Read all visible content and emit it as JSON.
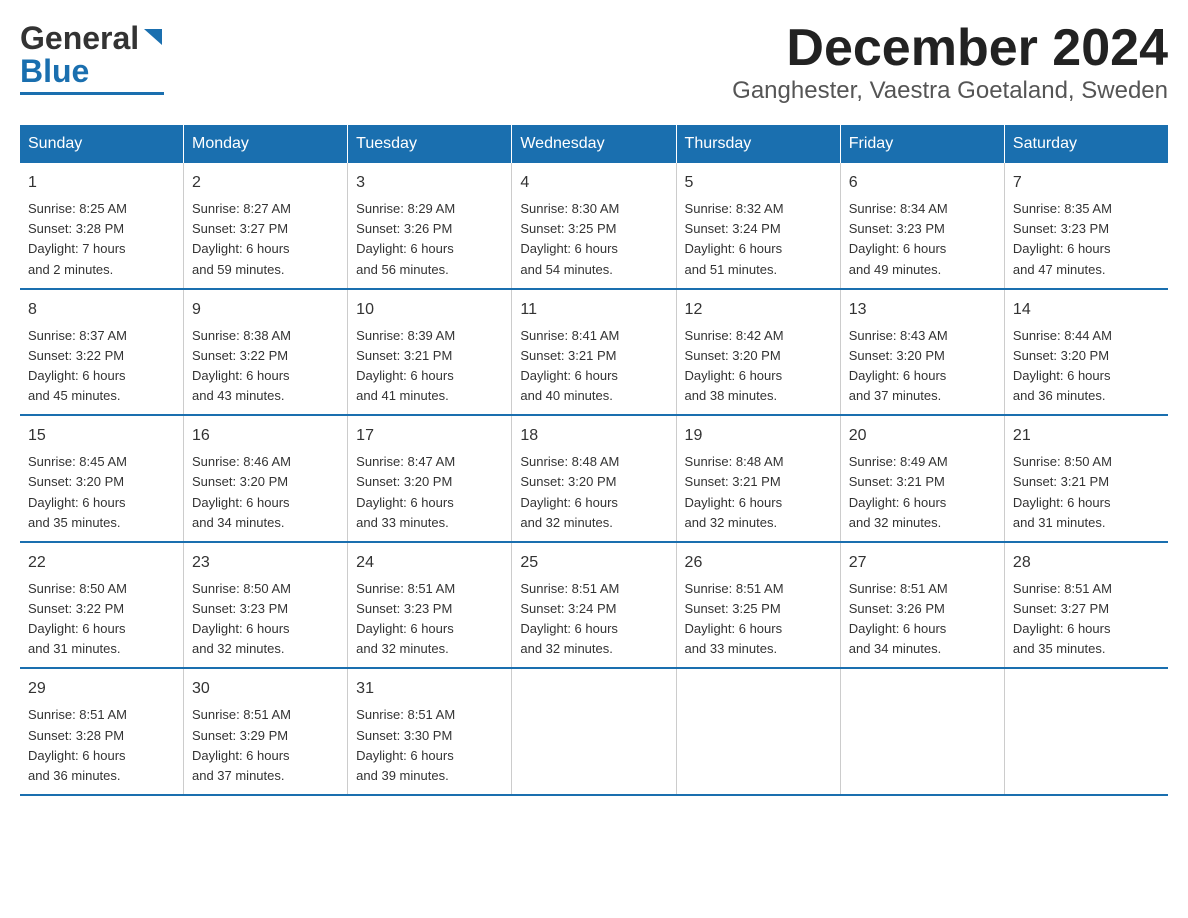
{
  "logo": {
    "general": "General",
    "blue": "Blue",
    "triangle": "▶"
  },
  "title": "December 2024",
  "subtitle": "Ganghester, Vaestra Goetaland, Sweden",
  "days_of_week": [
    "Sunday",
    "Monday",
    "Tuesday",
    "Wednesday",
    "Thursday",
    "Friday",
    "Saturday"
  ],
  "weeks": [
    [
      {
        "day": "1",
        "sunrise": "8:25 AM",
        "sunset": "3:28 PM",
        "daylight": "7 hours and 2 minutes."
      },
      {
        "day": "2",
        "sunrise": "8:27 AM",
        "sunset": "3:27 PM",
        "daylight": "6 hours and 59 minutes."
      },
      {
        "day": "3",
        "sunrise": "8:29 AM",
        "sunset": "3:26 PM",
        "daylight": "6 hours and 56 minutes."
      },
      {
        "day": "4",
        "sunrise": "8:30 AM",
        "sunset": "3:25 PM",
        "daylight": "6 hours and 54 minutes."
      },
      {
        "day": "5",
        "sunrise": "8:32 AM",
        "sunset": "3:24 PM",
        "daylight": "6 hours and 51 minutes."
      },
      {
        "day": "6",
        "sunrise": "8:34 AM",
        "sunset": "3:23 PM",
        "daylight": "6 hours and 49 minutes."
      },
      {
        "day": "7",
        "sunrise": "8:35 AM",
        "sunset": "3:23 PM",
        "daylight": "6 hours and 47 minutes."
      }
    ],
    [
      {
        "day": "8",
        "sunrise": "8:37 AM",
        "sunset": "3:22 PM",
        "daylight": "6 hours and 45 minutes."
      },
      {
        "day": "9",
        "sunrise": "8:38 AM",
        "sunset": "3:22 PM",
        "daylight": "6 hours and 43 minutes."
      },
      {
        "day": "10",
        "sunrise": "8:39 AM",
        "sunset": "3:21 PM",
        "daylight": "6 hours and 41 minutes."
      },
      {
        "day": "11",
        "sunrise": "8:41 AM",
        "sunset": "3:21 PM",
        "daylight": "6 hours and 40 minutes."
      },
      {
        "day": "12",
        "sunrise": "8:42 AM",
        "sunset": "3:20 PM",
        "daylight": "6 hours and 38 minutes."
      },
      {
        "day": "13",
        "sunrise": "8:43 AM",
        "sunset": "3:20 PM",
        "daylight": "6 hours and 37 minutes."
      },
      {
        "day": "14",
        "sunrise": "8:44 AM",
        "sunset": "3:20 PM",
        "daylight": "6 hours and 36 minutes."
      }
    ],
    [
      {
        "day": "15",
        "sunrise": "8:45 AM",
        "sunset": "3:20 PM",
        "daylight": "6 hours and 35 minutes."
      },
      {
        "day": "16",
        "sunrise": "8:46 AM",
        "sunset": "3:20 PM",
        "daylight": "6 hours and 34 minutes."
      },
      {
        "day": "17",
        "sunrise": "8:47 AM",
        "sunset": "3:20 PM",
        "daylight": "6 hours and 33 minutes."
      },
      {
        "day": "18",
        "sunrise": "8:48 AM",
        "sunset": "3:20 PM",
        "daylight": "6 hours and 32 minutes."
      },
      {
        "day": "19",
        "sunrise": "8:48 AM",
        "sunset": "3:21 PM",
        "daylight": "6 hours and 32 minutes."
      },
      {
        "day": "20",
        "sunrise": "8:49 AM",
        "sunset": "3:21 PM",
        "daylight": "6 hours and 32 minutes."
      },
      {
        "day": "21",
        "sunrise": "8:50 AM",
        "sunset": "3:21 PM",
        "daylight": "6 hours and 31 minutes."
      }
    ],
    [
      {
        "day": "22",
        "sunrise": "8:50 AM",
        "sunset": "3:22 PM",
        "daylight": "6 hours and 31 minutes."
      },
      {
        "day": "23",
        "sunrise": "8:50 AM",
        "sunset": "3:23 PM",
        "daylight": "6 hours and 32 minutes."
      },
      {
        "day": "24",
        "sunrise": "8:51 AM",
        "sunset": "3:23 PM",
        "daylight": "6 hours and 32 minutes."
      },
      {
        "day": "25",
        "sunrise": "8:51 AM",
        "sunset": "3:24 PM",
        "daylight": "6 hours and 32 minutes."
      },
      {
        "day": "26",
        "sunrise": "8:51 AM",
        "sunset": "3:25 PM",
        "daylight": "6 hours and 33 minutes."
      },
      {
        "day": "27",
        "sunrise": "8:51 AM",
        "sunset": "3:26 PM",
        "daylight": "6 hours and 34 minutes."
      },
      {
        "day": "28",
        "sunrise": "8:51 AM",
        "sunset": "3:27 PM",
        "daylight": "6 hours and 35 minutes."
      }
    ],
    [
      {
        "day": "29",
        "sunrise": "8:51 AM",
        "sunset": "3:28 PM",
        "daylight": "6 hours and 36 minutes."
      },
      {
        "day": "30",
        "sunrise": "8:51 AM",
        "sunset": "3:29 PM",
        "daylight": "6 hours and 37 minutes."
      },
      {
        "day": "31",
        "sunrise": "8:51 AM",
        "sunset": "3:30 PM",
        "daylight": "6 hours and 39 minutes."
      },
      {
        "day": "",
        "sunrise": "",
        "sunset": "",
        "daylight": ""
      },
      {
        "day": "",
        "sunrise": "",
        "sunset": "",
        "daylight": ""
      },
      {
        "day": "",
        "sunrise": "",
        "sunset": "",
        "daylight": ""
      },
      {
        "day": "",
        "sunrise": "",
        "sunset": "",
        "daylight": ""
      }
    ]
  ],
  "labels": {
    "sunrise": "Sunrise:",
    "sunset": "Sunset:",
    "daylight": "Daylight:"
  }
}
